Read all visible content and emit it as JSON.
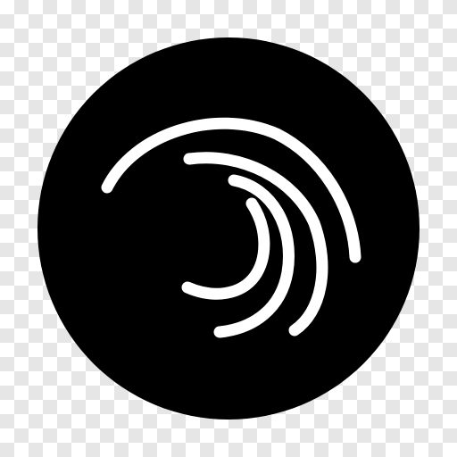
{
  "logo": {
    "icon": "spiral-arcs-logo",
    "background_color": "#000000",
    "arc_color": "#ffffff"
  },
  "checkerboard": {
    "light": "#ffffff",
    "dark": "#e6e6e6"
  }
}
